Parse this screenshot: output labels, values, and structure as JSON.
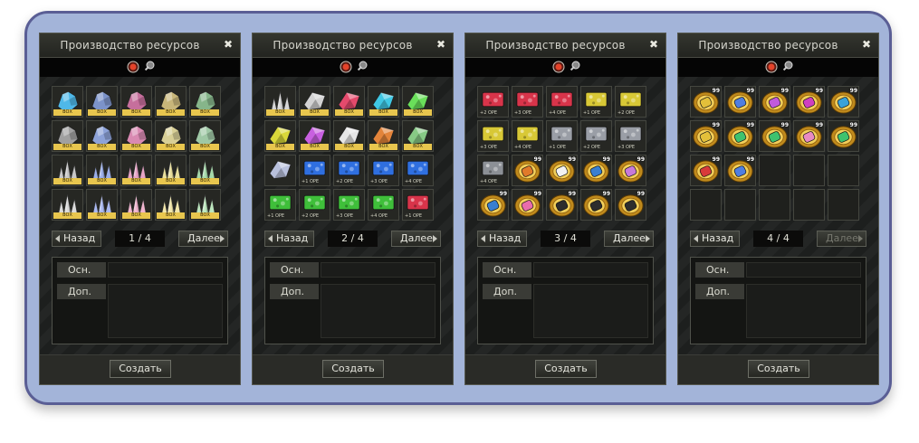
{
  "windows": [
    {
      "title": "Производство ресурсов",
      "page": "1 / 4",
      "prev_label": "Назад",
      "next_label": "Далее",
      "next_enabled": true,
      "main_label": "Осн.",
      "extra_label": "Доп.",
      "create_label": "Создать",
      "slots": [
        {
          "type": "ore",
          "color": "#4fb8e8",
          "text": "ВОХ"
        },
        {
          "type": "ore",
          "color": "#7c93c9",
          "text": "ВОХ"
        },
        {
          "type": "ore",
          "color": "#c66f9c",
          "text": "ВОХ"
        },
        {
          "type": "ore",
          "color": "#c8b67a",
          "text": "ВОХ"
        },
        {
          "type": "ore",
          "color": "#86b58a",
          "text": "ВОХ"
        },
        {
          "type": "ore",
          "color": "#a0a0a0",
          "text": "ВОХ"
        },
        {
          "type": "ore",
          "color": "#8da2d8",
          "text": "ВОХ"
        },
        {
          "type": "ore",
          "color": "#d98ab2",
          "text": "ВОХ"
        },
        {
          "type": "ore",
          "color": "#d8cf96",
          "text": "ВОХ"
        },
        {
          "type": "ore",
          "color": "#9fc8a5",
          "text": "ВОХ"
        },
        {
          "type": "crystal",
          "color": "#c8c8c8",
          "text": "ВОХ"
        },
        {
          "type": "crystal",
          "color": "#9aaee8",
          "text": "ВОХ"
        },
        {
          "type": "crystal",
          "color": "#e7a4c6",
          "text": "ВОХ"
        },
        {
          "type": "crystal",
          "color": "#e9df9c",
          "text": "ВОХ"
        },
        {
          "type": "crystal",
          "color": "#a6d9aa",
          "text": "ВОХ"
        },
        {
          "type": "crystal",
          "color": "#dadada",
          "text": "ВОХ"
        },
        {
          "type": "crystal",
          "color": "#a9b8f0",
          "text": "ВОХ"
        },
        {
          "type": "crystal",
          "color": "#f0b5cf",
          "text": "ВОХ"
        },
        {
          "type": "crystal",
          "color": "#f1e6aa",
          "text": "ВОХ"
        },
        {
          "type": "crystal",
          "color": "#bce6bd",
          "text": "ВОХ"
        }
      ]
    },
    {
      "title": "Производство ресурсов",
      "page": "2 / 4",
      "prev_label": "Назад",
      "next_label": "Далее",
      "next_enabled": true,
      "main_label": "Осн.",
      "extra_label": "Доп.",
      "create_label": "Создать",
      "slots": [
        {
          "type": "crystal",
          "color": "#d6d6d6",
          "text": "ВОХ"
        },
        {
          "type": "shard",
          "color": "#d3d3d3",
          "text": "ВОХ"
        },
        {
          "type": "shard",
          "color": "#e44a6c",
          "text": "ВОХ"
        },
        {
          "type": "shard",
          "color": "#3fc8e4",
          "text": "ВОХ"
        },
        {
          "type": "shard",
          "color": "#6adf5a",
          "text": "ВОХ"
        },
        {
          "type": "shard",
          "color": "#d9d83a",
          "text": "ВОХ"
        },
        {
          "type": "shard",
          "color": "#c860e0",
          "text": "ВОХ"
        },
        {
          "type": "shard",
          "color": "#e6e6e6",
          "text": "ВОХ"
        },
        {
          "type": "shard",
          "color": "#e3843a",
          "text": "ВОХ"
        },
        {
          "type": "shard",
          "color": "#87c985",
          "text": "ВОХ"
        },
        {
          "type": "shard",
          "color": "#b8c0dc",
          "text": ""
        },
        {
          "type": "gem",
          "color": "#2f6fe0",
          "text": "+1 ОРЕ"
        },
        {
          "type": "gem",
          "color": "#2f6fe0",
          "text": "+2 ОРЕ"
        },
        {
          "type": "gem",
          "color": "#2f6fe0",
          "text": "+3 ОРЕ"
        },
        {
          "type": "gem",
          "color": "#2f6fe0",
          "text": "+4 ОРЕ"
        },
        {
          "type": "gem",
          "color": "#3fbf3a",
          "text": "+1 ОРЕ"
        },
        {
          "type": "gem",
          "color": "#3fbf3a",
          "text": "+2 ОРЕ"
        },
        {
          "type": "gem",
          "color": "#3fbf3a",
          "text": "+3 ОРЕ"
        },
        {
          "type": "gem",
          "color": "#3fbf3a",
          "text": "+4 ОРЕ"
        },
        {
          "type": "gem",
          "color": "#d8344a",
          "text": "+1 ОРЕ"
        }
      ]
    },
    {
      "title": "Производство ресурсов",
      "page": "3 / 4",
      "prev_label": "Назад",
      "next_label": "Далее",
      "next_enabled": true,
      "main_label": "Осн.",
      "extra_label": "Доп.",
      "create_label": "Создать",
      "slots": [
        {
          "type": "gem",
          "color": "#d8344a",
          "text": "+2 ОРЕ"
        },
        {
          "type": "gem",
          "color": "#d8344a",
          "text": "+3 ОРЕ"
        },
        {
          "type": "gem",
          "color": "#d8344a",
          "text": "+4 ОРЕ"
        },
        {
          "type": "gem",
          "color": "#d8c836",
          "text": "+1 ОРЕ"
        },
        {
          "type": "gem",
          "color": "#d8c836",
          "text": "+2 ОРЕ"
        },
        {
          "type": "gem",
          "color": "#d8c836",
          "text": "+3 ОРЕ"
        },
        {
          "type": "gem",
          "color": "#d8c836",
          "text": "+4 ОРЕ"
        },
        {
          "type": "gem",
          "color": "#9a9ea6",
          "text": "+1 ОРЕ"
        },
        {
          "type": "gem",
          "color": "#9a9ea6",
          "text": "+2 ОРЕ"
        },
        {
          "type": "gem",
          "color": "#9a9ea6",
          "text": "+3 ОРЕ"
        },
        {
          "type": "gem",
          "color": "#8c9096",
          "text": "+4 ОРЕ"
        },
        {
          "type": "bundle",
          "color": "#e07a2a",
          "text": "99"
        },
        {
          "type": "bundle",
          "color": "#f2f2f2",
          "text": "99"
        },
        {
          "type": "bundle",
          "color": "#3a7fd0",
          "text": "99"
        },
        {
          "type": "bundle",
          "color": "#c77ad8",
          "text": "99"
        },
        {
          "type": "bundle",
          "color": "#3a7fd0",
          "text": "99"
        },
        {
          "type": "bundle",
          "color": "#e86cab",
          "text": "99"
        },
        {
          "type": "bundle",
          "color": "#2d2d2d",
          "text": "99"
        },
        {
          "type": "bundle",
          "color": "#2d2d2d",
          "text": "99"
        },
        {
          "type": "bundle",
          "color": "#2d2d2d",
          "text": "99"
        }
      ]
    },
    {
      "title": "Производство ресурсов",
      "page": "4 / 4",
      "prev_label": "Назад",
      "next_label": "Далее",
      "next_enabled": false,
      "main_label": "Осн.",
      "extra_label": "Доп.",
      "create_label": "Создать",
      "slots": [
        {
          "type": "bundle",
          "color": "#e3c03a",
          "text": "99"
        },
        {
          "type": "bundle",
          "color": "#4f7ee0",
          "text": "99"
        },
        {
          "type": "bundle",
          "color": "#c15adb",
          "text": "99"
        },
        {
          "type": "bundle",
          "color": "#cf3fc0",
          "text": "99"
        },
        {
          "type": "bundle",
          "color": "#3aa2d8",
          "text": "99"
        },
        {
          "type": "bundle",
          "color": "#e3c03a",
          "text": "99"
        },
        {
          "type": "bundle",
          "color": "#3fc26e",
          "text": "99"
        },
        {
          "type": "bundle",
          "color": "#3fc26e",
          "text": "99"
        },
        {
          "type": "bundle",
          "color": "#e88ac2",
          "text": "99"
        },
        {
          "type": "bundle",
          "color": "#3fc26e",
          "text": "99"
        },
        {
          "type": "bundle",
          "color": "#d83a3a",
          "text": "99"
        },
        {
          "type": "bundle",
          "color": "#4f7ee0",
          "text": "99"
        },
        {
          "type": "empty",
          "color": "",
          "text": ""
        },
        {
          "type": "empty",
          "color": "",
          "text": ""
        },
        {
          "type": "empty",
          "color": "",
          "text": ""
        },
        {
          "type": "empty",
          "color": "",
          "text": ""
        },
        {
          "type": "empty",
          "color": "",
          "text": ""
        },
        {
          "type": "empty",
          "color": "",
          "text": ""
        },
        {
          "type": "empty",
          "color": "",
          "text": ""
        },
        {
          "type": "empty",
          "color": "",
          "text": ""
        }
      ]
    }
  ],
  "icons": {
    "fire": "fire-gem-icon",
    "key": "magnifier-key-icon",
    "close": "close-icon"
  },
  "colors": {
    "frame": "#a3b4d9",
    "frame_border": "#5a5e95",
    "qty_label": "#e8c64e"
  }
}
